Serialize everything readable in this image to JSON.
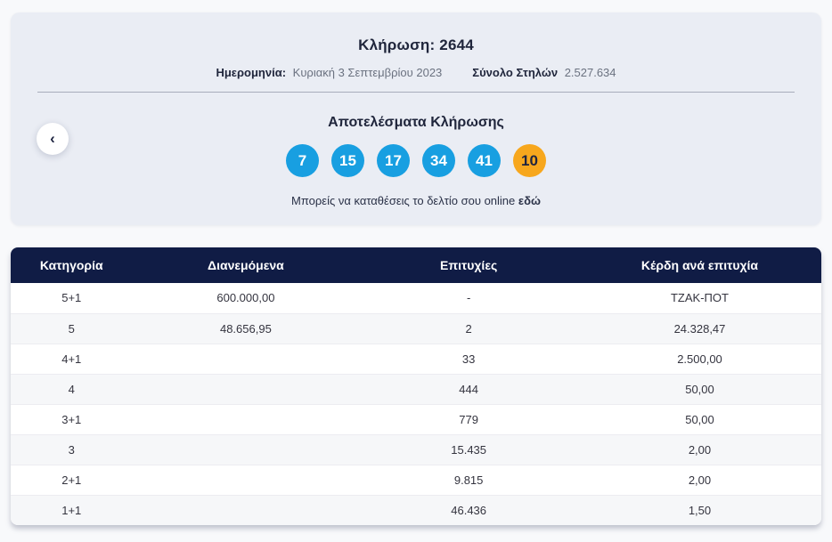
{
  "draw": {
    "title": "Κλήρωση: 2644",
    "date_label": "Ημερομηνία:",
    "date_value": "Κυριακή 3 Σεπτεμβρίου 2023",
    "columns_label": "Σύνολο Στηλών",
    "columns_value": "2.527.634",
    "results_title": "Αποτελέσματα Κλήρωσης",
    "numbers": [
      "7",
      "15",
      "17",
      "34",
      "41"
    ],
    "joker": "10",
    "cta_text": "Μπορείς να καταθέσεις το δελτίο σου online",
    "cta_link": "εδώ"
  },
  "nav": {
    "prev_icon": "‹"
  },
  "table": {
    "headers": [
      "Κατηγορία",
      "Διανεμόμενα",
      "Επιτυχίες",
      "Κέρδη ανά επιτυχία"
    ],
    "rows": [
      [
        "5+1",
        "600.000,00",
        "-",
        "ΤΖΑΚ-ΠΟΤ"
      ],
      [
        "5",
        "48.656,95",
        "2",
        "24.328,47"
      ],
      [
        "4+1",
        "",
        "33",
        "2.500,00"
      ],
      [
        "4",
        "",
        "444",
        "50,00"
      ],
      [
        "3+1",
        "",
        "779",
        "50,00"
      ],
      [
        "3",
        "",
        "15.435",
        "2,00"
      ],
      [
        "2+1",
        "",
        "9.815",
        "2,00"
      ],
      [
        "1+1",
        "",
        "46.436",
        "1,50"
      ]
    ]
  },
  "colors": {
    "page_bg": "#f8f9fb",
    "card_bg": "#eaedf4",
    "heading_text": "#20263c",
    "muted_text": "#6b7280",
    "ball_blue": "#189fe1",
    "joker_orange": "#f7a71d",
    "header_navy": "#101c45",
    "row_stripe": "#f6f7f9"
  }
}
